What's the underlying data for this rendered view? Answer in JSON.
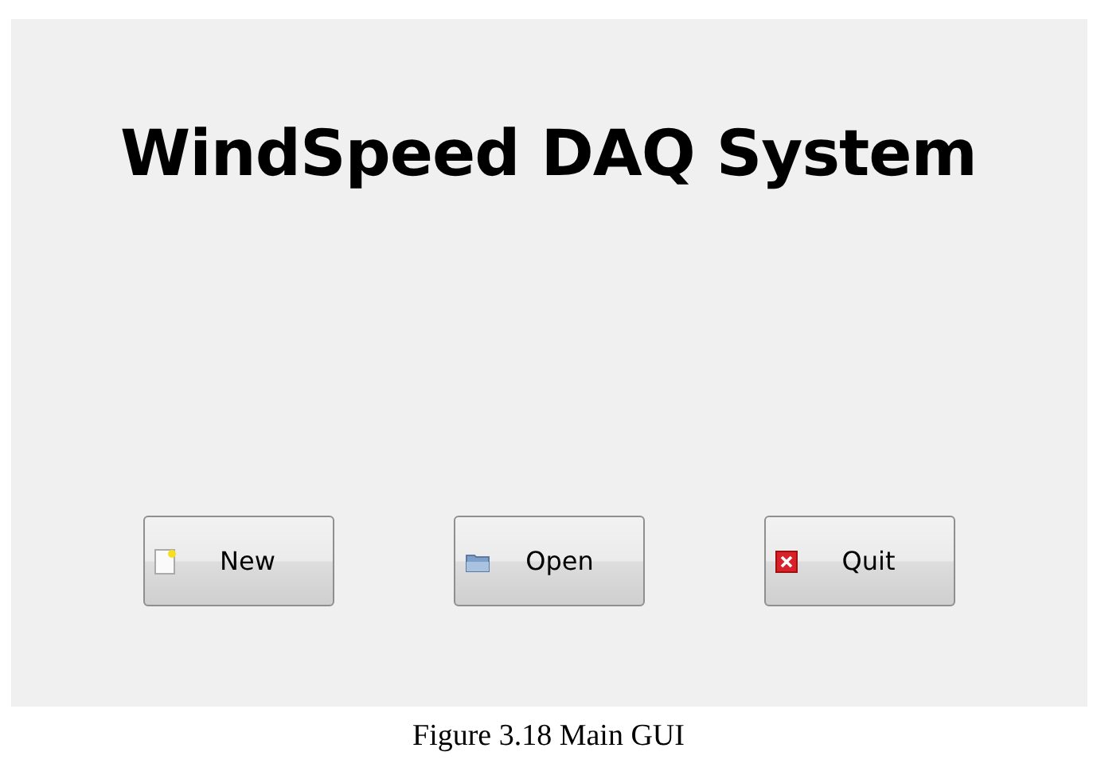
{
  "window": {
    "title": "WindSpeed DAQ System"
  },
  "buttons": [
    {
      "label": "New",
      "kind": "new"
    },
    {
      "label": "Open",
      "kind": "open"
    },
    {
      "label": "Quit",
      "kind": "quit"
    }
  ],
  "caption": "Figure 3.18 Main GUI"
}
